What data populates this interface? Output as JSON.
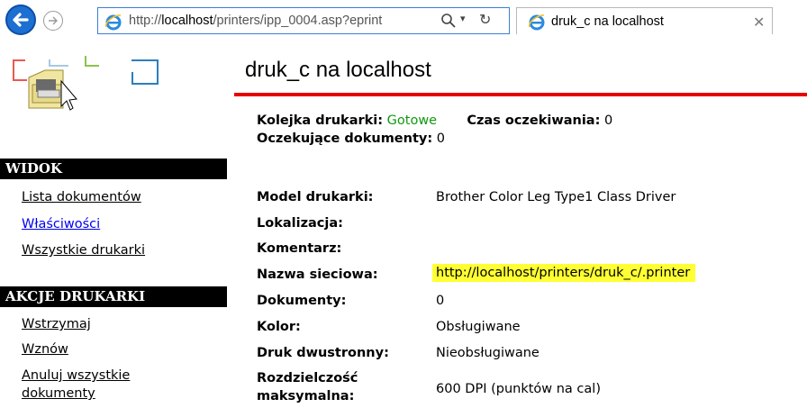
{
  "browser": {
    "url_prefix": "http://",
    "url_host": "localhost",
    "url_rest": "/printers/ipp_0004.asp?eprint",
    "tab_title": "druk_c na localhost"
  },
  "header": {
    "title": "druk_c na localhost"
  },
  "status": {
    "queue_label": "Kolejka drukarki:",
    "queue_value": "Gotowe",
    "wait_label": "Czas oczekiwania:",
    "wait_value": "0",
    "pending_label": "Oczekujące dokumenty:",
    "pending_value": "0"
  },
  "sidebar": {
    "view_heading": "WIDOK",
    "view_items": [
      {
        "label": "Lista dokumentów"
      },
      {
        "label": "Właściwości"
      },
      {
        "label": "Wszystkie drukarki"
      }
    ],
    "actions_heading": "AKCJE DRUKARKI",
    "action_items": [
      {
        "label": "Wstrzymaj"
      },
      {
        "label": "Wznów"
      },
      {
        "label": "Anuluj wszystkie"
      },
      {
        "label": "dokumenty"
      }
    ]
  },
  "properties": [
    {
      "label": "Model drukarki:",
      "value": "Brother Color Leg Type1 Class Driver"
    },
    {
      "label": "Lokalizacja:",
      "value": ""
    },
    {
      "label": "Komentarz:",
      "value": ""
    },
    {
      "label": "Nazwa sieciowa:",
      "value": "http://localhost/printers/druk_c/.printer"
    },
    {
      "label": "Dokumenty:",
      "value": "0"
    },
    {
      "label": "Kolor:",
      "value": "Obsługiwane"
    },
    {
      "label": "Druk dwustronny:",
      "value": "Nieobsługiwane"
    },
    {
      "label": "Rozdzielczość",
      "value": "600 DPI (punktów na cal)"
    },
    {
      "label": "maksymalna:",
      "value": ""
    }
  ],
  "colors": {
    "accent_red": "#e60000",
    "status_green": "#119911",
    "highlight": "#ffff33",
    "link_blue": "#0000ee"
  }
}
